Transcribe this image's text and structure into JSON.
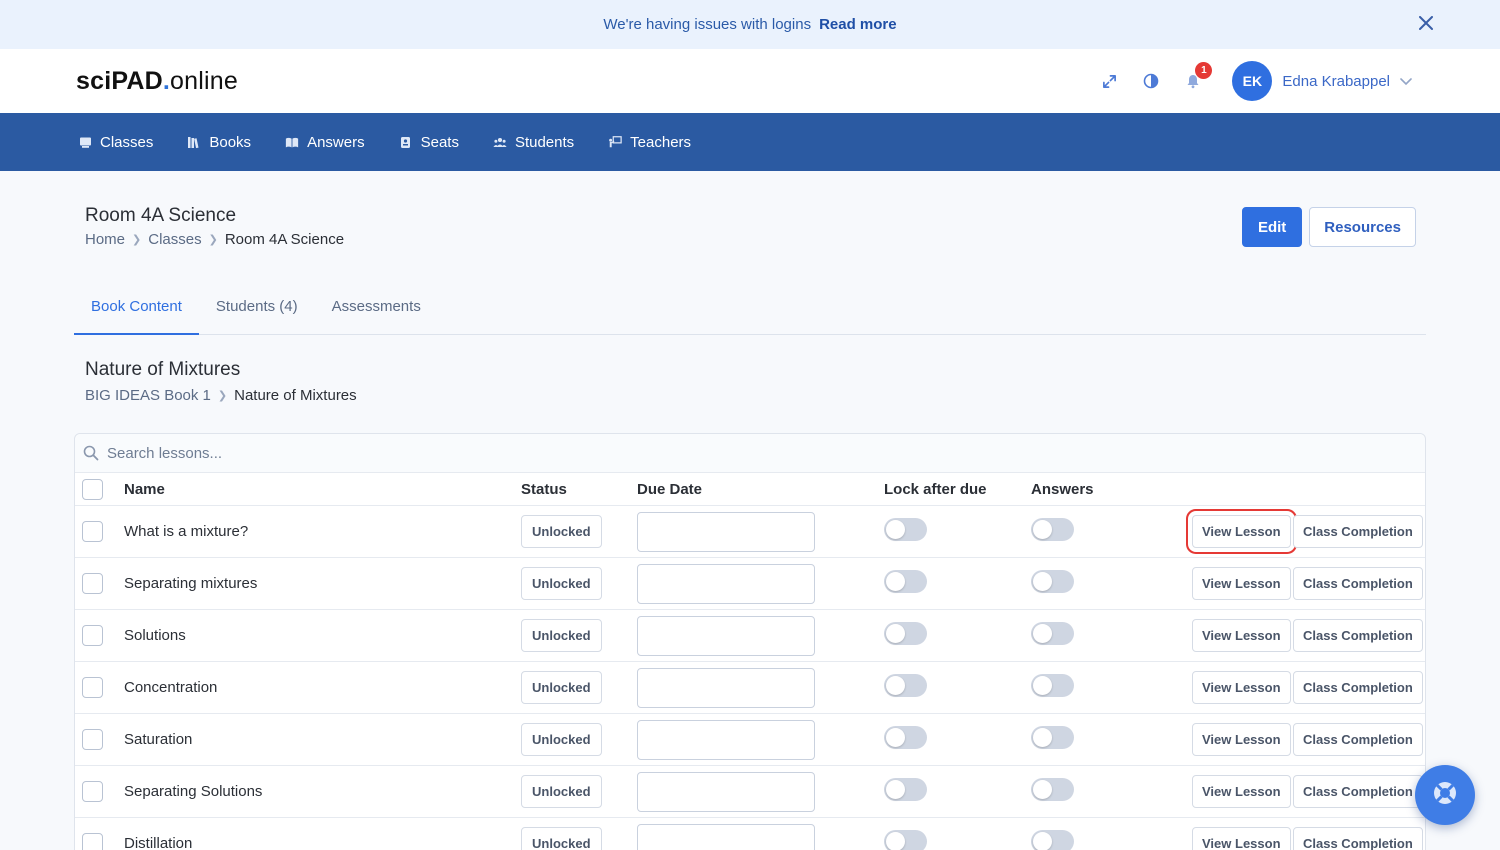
{
  "banner": {
    "message": "We're having issues with logins",
    "link": "Read more"
  },
  "header": {
    "logo_part1": "sciPAD",
    "logo_dot": ".",
    "logo_part2": "online",
    "notification_count": "1",
    "avatar_initials": "EK",
    "user_name": "Edna Krabappel"
  },
  "nav": {
    "items": [
      {
        "label": "Classes",
        "icon": "classes-icon"
      },
      {
        "label": "Books",
        "icon": "books-icon"
      },
      {
        "label": "Answers",
        "icon": "answers-icon"
      },
      {
        "label": "Seats",
        "icon": "seats-icon"
      },
      {
        "label": "Students",
        "icon": "students-icon"
      },
      {
        "label": "Teachers",
        "icon": "teachers-icon"
      }
    ]
  },
  "page": {
    "title": "Room 4A Science",
    "breadcrumb": [
      "Home",
      "Classes",
      "Room 4A Science"
    ],
    "edit_label": "Edit",
    "resources_label": "Resources"
  },
  "tabs": [
    {
      "label": "Book Content",
      "active": true
    },
    {
      "label": "Students (4)",
      "active": false
    },
    {
      "label": "Assessments",
      "active": false
    }
  ],
  "section": {
    "title": "Nature of Mixtures",
    "breadcrumb": [
      "BIG IDEAS Book 1",
      "Nature of Mixtures"
    ]
  },
  "table": {
    "search_placeholder": "Search lessons...",
    "headers": {
      "name": "Name",
      "status": "Status",
      "due_date": "Due Date",
      "lock": "Lock after due",
      "answers": "Answers"
    },
    "view_label": "View Lesson",
    "completion_label": "Class Completion",
    "rows": [
      {
        "name": "What is a mixture?",
        "status": "Unlocked"
      },
      {
        "name": "Separating mixtures",
        "status": "Unlocked"
      },
      {
        "name": "Solutions",
        "status": "Unlocked"
      },
      {
        "name": "Concentration",
        "status": "Unlocked"
      },
      {
        "name": "Saturation",
        "status": "Unlocked"
      },
      {
        "name": "Separating Solutions",
        "status": "Unlocked"
      },
      {
        "name": "Distillation",
        "status": "Unlocked"
      }
    ]
  },
  "colors": {
    "accent": "#2f6fe0",
    "nav_bg": "#2b5aa2",
    "banner_bg": "#eaf2fd",
    "highlight": "#e53935"
  }
}
